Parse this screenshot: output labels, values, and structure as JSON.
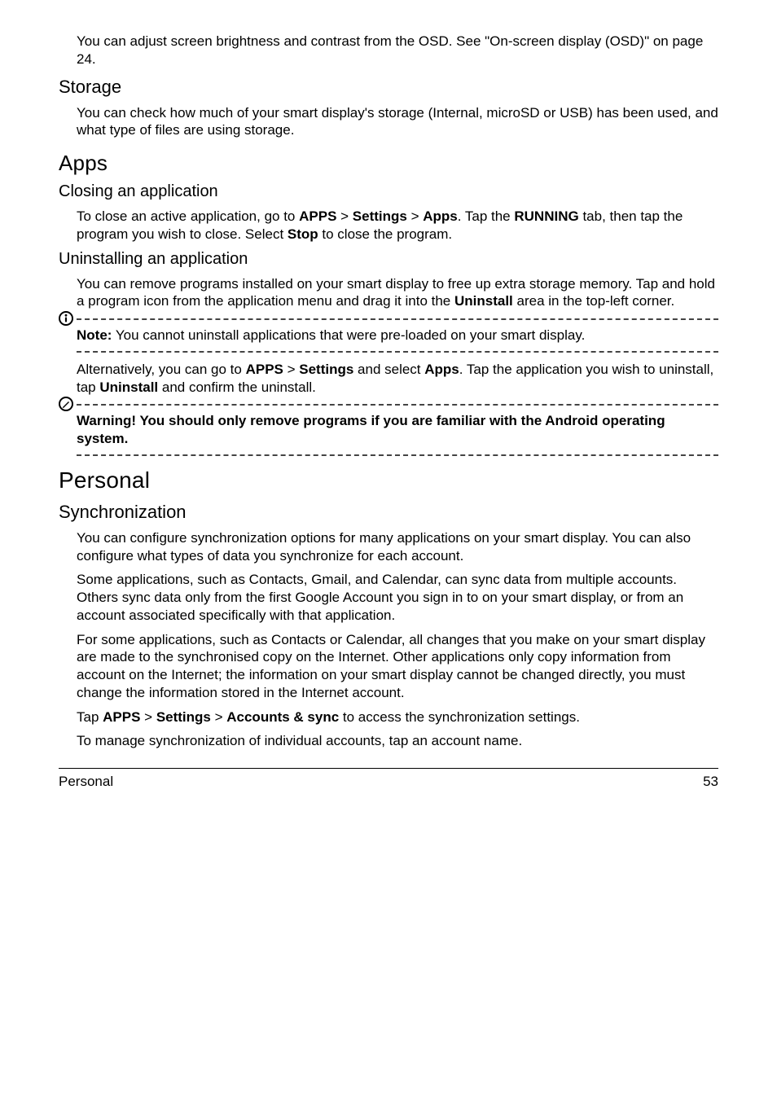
{
  "intro": {
    "brightness": "You can adjust screen brightness and contrast from the OSD. See \"On-screen display (OSD)\" on page 24."
  },
  "storage": {
    "h": "Storage",
    "p": "You can check how much of your smart display's storage (Internal, microSD or USB) has been used, and what type of files are using storage."
  },
  "apps": {
    "h": "Apps",
    "closing": {
      "h": "Closing an application",
      "p_pre": "To close an active application, go to ",
      "apps": "APPS",
      "gt1": " > ",
      "settings": "Settings",
      "gt2": " > ",
      "apps2": "Apps",
      "p_mid": ". Tap the ",
      "running": "RUNNING",
      "p_tail": " tab, then tap the program you wish to close. Select ",
      "stop": "Stop",
      "p_end": " to close the program."
    },
    "uninstall": {
      "h": "Uninstalling an application",
      "p1_a": "You can remove programs installed on your smart display to free up extra storage memory. Tap and hold a program icon from the application menu and drag it into the ",
      "uninstall": "Uninstall",
      "p1_b": " area in the top-left corner.",
      "note_label": "Note:",
      "note_body": " You cannot uninstall applications that were pre-loaded on your smart display.",
      "p2_a": "Alternatively, you can go to ",
      "apps": "APPS",
      "gt1": " > ",
      "settings": "Settings",
      "p2_b": " and select ",
      "apps2": "Apps",
      "p2_c": ". Tap the application you wish to uninstall, tap ",
      "uninstall2": "Uninstall",
      "p2_d": " and confirm the uninstall.",
      "warn": "Warning! You should only remove programs if you are familiar with the Android operating system."
    }
  },
  "personal": {
    "h": "Personal",
    "sync": {
      "h": "Synchronization",
      "p1": "You can configure synchronization options for many applications on your smart display. You can also configure what types of data you synchronize for each account.",
      "p2": "Some applications, such as Contacts, Gmail, and Calendar, can sync data from multiple accounts. Others sync data only from the first Google Account you sign in to on your smart display, or from an account associated specifically with that application.",
      "p3": "For some applications, such as Contacts or Calendar, all changes that you make on your smart display are made to the synchronised copy on the Internet. Other applications only copy information from account on the Internet; the information on your smart display cannot be changed directly, you must change the information stored in the Internet account.",
      "p4_a": "Tap ",
      "apps": "APPS",
      "gt1": " > ",
      "settings": "Settings",
      "gt2": " > ",
      "acct": "Accounts & sync",
      "p4_b": " to access the synchronization settings.",
      "p5": "To manage synchronization of individual accounts, tap an account name."
    }
  },
  "footer": {
    "left": "Personal",
    "right": "53"
  }
}
